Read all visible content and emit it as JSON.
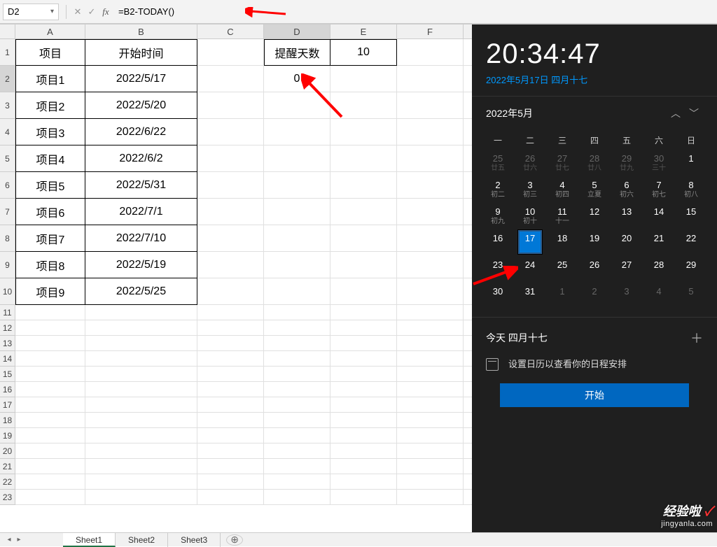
{
  "name_box": "D2",
  "formula": "=B2-TODAY()",
  "columns": [
    "A",
    "B",
    "C",
    "D",
    "E",
    "F"
  ],
  "headers": {
    "A": "项目",
    "B": "开始时间",
    "C": "",
    "D": "提醒天数",
    "E": "10"
  },
  "d2_value": "0",
  "table": [
    {
      "a": "项目1",
      "b": "2022/5/17"
    },
    {
      "a": "项目2",
      "b": "2022/5/20"
    },
    {
      "a": "项目3",
      "b": "2022/6/22"
    },
    {
      "a": "项目4",
      "b": "2022/6/2"
    },
    {
      "a": "项目5",
      "b": "2022/5/31"
    },
    {
      "a": "项目6",
      "b": "2022/7/1"
    },
    {
      "a": "项目7",
      "b": "2022/7/10"
    },
    {
      "a": "项目8",
      "b": "2022/5/19"
    },
    {
      "a": "项目9",
      "b": "2022/5/25"
    }
  ],
  "clock": {
    "time": "20:34:47",
    "date": "2022年5月17日 四月十七"
  },
  "calendar": {
    "month_label": "2022年5月",
    "weekdays": [
      "一",
      "二",
      "三",
      "四",
      "五",
      "六",
      "日"
    ],
    "rows": [
      [
        {
          "n": "25",
          "s": "廿五",
          "dim": true
        },
        {
          "n": "26",
          "s": "廿六",
          "dim": true
        },
        {
          "n": "27",
          "s": "廿七",
          "dim": true
        },
        {
          "n": "28",
          "s": "廿八",
          "dim": true
        },
        {
          "n": "29",
          "s": "廿九",
          "dim": true
        },
        {
          "n": "30",
          "s": "三十",
          "dim": true
        },
        {
          "n": "1",
          "s": "",
          "dim": false
        }
      ],
      [
        {
          "n": "2",
          "s": "初二"
        },
        {
          "n": "3",
          "s": "初三"
        },
        {
          "n": "4",
          "s": "初四"
        },
        {
          "n": "5",
          "s": "立夏"
        },
        {
          "n": "6",
          "s": "初六"
        },
        {
          "n": "7",
          "s": "初七"
        },
        {
          "n": "8",
          "s": "初八"
        }
      ],
      [
        {
          "n": "9",
          "s": "初九"
        },
        {
          "n": "10",
          "s": "初十"
        },
        {
          "n": "11",
          "s": "十一"
        },
        {
          "n": "12",
          "s": ""
        },
        {
          "n": "13",
          "s": ""
        },
        {
          "n": "14",
          "s": ""
        },
        {
          "n": "15",
          "s": ""
        }
      ],
      [
        {
          "n": "16",
          "s": ""
        },
        {
          "n": "17",
          "s": "",
          "today": true
        },
        {
          "n": "18",
          "s": ""
        },
        {
          "n": "19",
          "s": ""
        },
        {
          "n": "20",
          "s": ""
        },
        {
          "n": "21",
          "s": ""
        },
        {
          "n": "22",
          "s": ""
        }
      ],
      [
        {
          "n": "23",
          "s": ""
        },
        {
          "n": "24",
          "s": ""
        },
        {
          "n": "25",
          "s": ""
        },
        {
          "n": "26",
          "s": ""
        },
        {
          "n": "27",
          "s": ""
        },
        {
          "n": "28",
          "s": ""
        },
        {
          "n": "29",
          "s": ""
        }
      ],
      [
        {
          "n": "30",
          "s": ""
        },
        {
          "n": "31",
          "s": ""
        },
        {
          "n": "1",
          "s": "",
          "dim": true
        },
        {
          "n": "2",
          "s": "",
          "dim": true
        },
        {
          "n": "3",
          "s": "",
          "dim": true
        },
        {
          "n": "4",
          "s": "",
          "dim": true
        },
        {
          "n": "5",
          "s": "",
          "dim": true
        }
      ]
    ]
  },
  "agenda": {
    "today_label": "今天 四月十七",
    "hint": "设置日历以查看你的日程安排",
    "start": "开始"
  },
  "sheet_tabs": [
    "Sheet1",
    "Sheet2",
    "Sheet3"
  ],
  "watermark": {
    "line1": "经验啦",
    "check": "✓",
    "line2": "jingyanla.com"
  }
}
